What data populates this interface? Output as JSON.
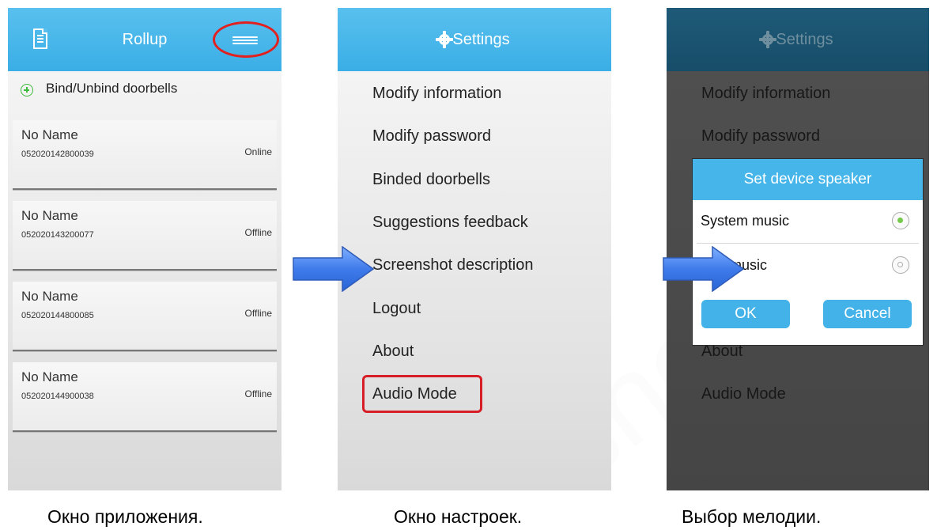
{
  "panel1": {
    "title": "Rollup",
    "bind_label": "Bind/Unbind doorbells",
    "devices": [
      {
        "name": "No Name",
        "id": "052020142800039",
        "status": "Online"
      },
      {
        "name": "No Name",
        "id": "052020143200077",
        "status": "Offline"
      },
      {
        "name": "No Name",
        "id": "052020144800085",
        "status": "Offline"
      },
      {
        "name": "No Name",
        "id": "052020144900038",
        "status": "Offline"
      }
    ],
    "caption": "Окно приложения."
  },
  "panel2": {
    "title": "Settings",
    "items": [
      "Modify information",
      "Modify password",
      "Binded doorbells",
      "Suggestions feedback",
      "Screenshot description",
      "Logout",
      "About",
      "Audio Mode"
    ],
    "caption": "Окно настроек."
  },
  "panel3": {
    "title": "Settings",
    "items_visible": [
      "Modify information",
      "Modify password",
      "About",
      "Audio Mode"
    ],
    "dialog": {
      "title": "Set device speaker",
      "options": [
        {
          "label": "System music",
          "selected": true
        },
        {
          "label": "App music",
          "selected": false
        }
      ],
      "ok_label": "OK",
      "cancel_label": "Cancel"
    },
    "caption": "Выбор мелодии."
  },
  "colors": {
    "accent": "#45b5ea",
    "highlight": "#e2201f",
    "arrow": "#3f7bea"
  }
}
